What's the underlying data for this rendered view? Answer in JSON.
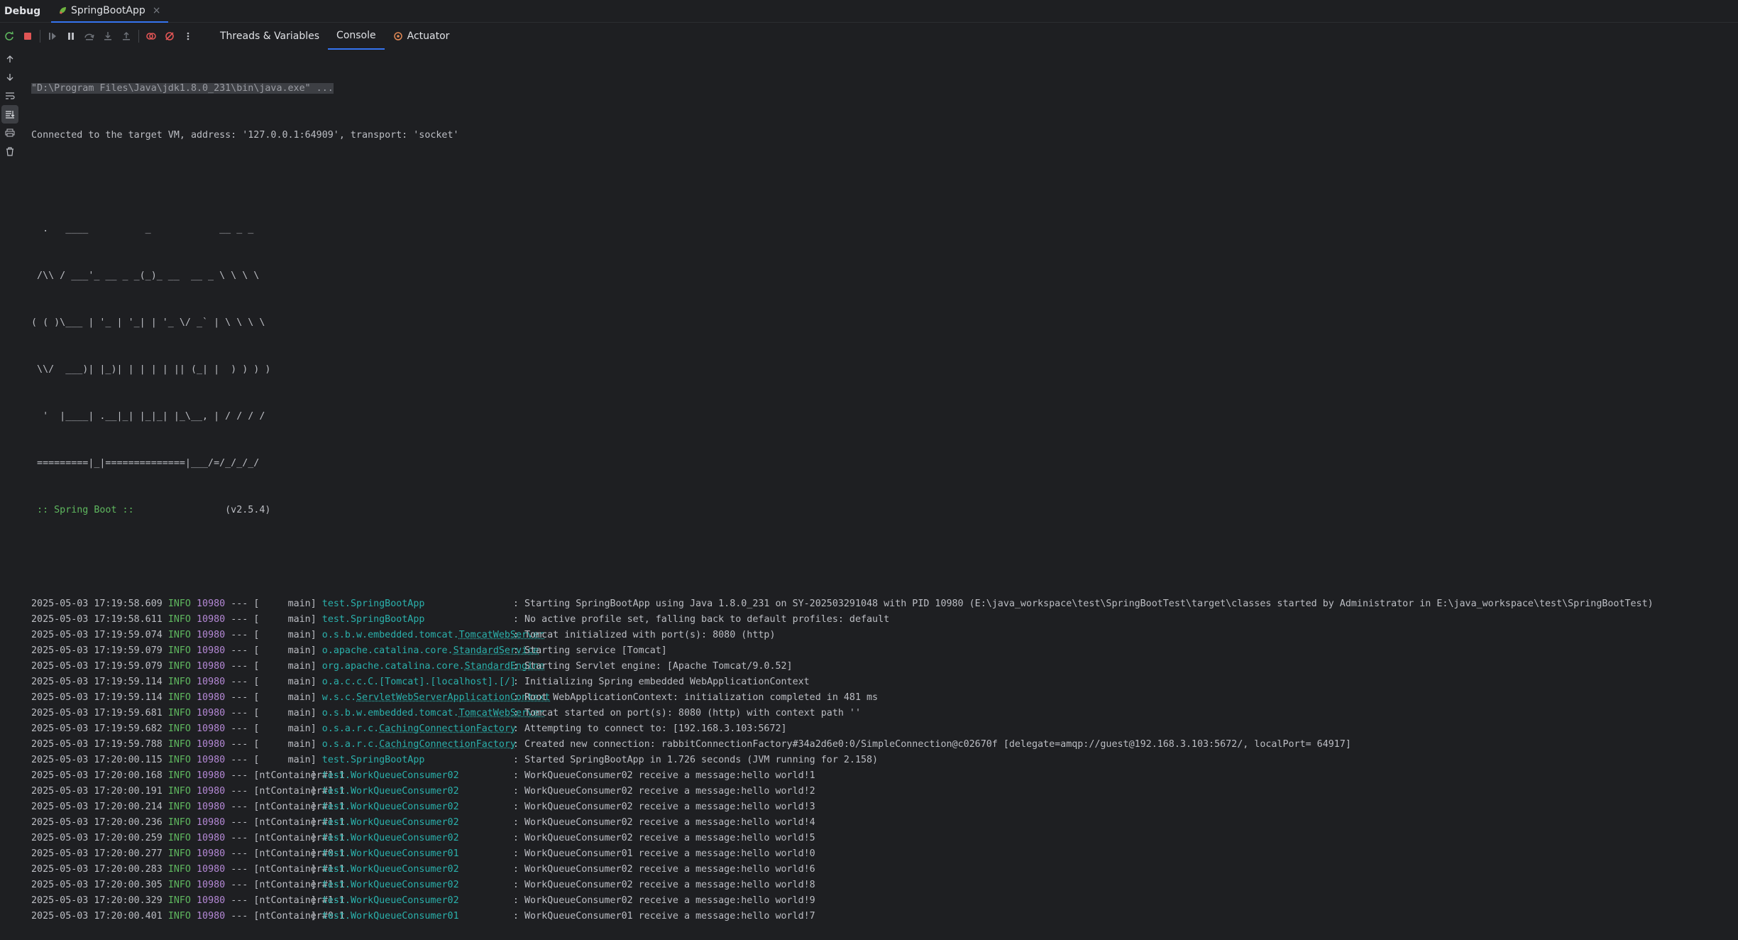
{
  "header": {
    "title": "Debug",
    "run_tab": "SpringBootApp",
    "close_glyph": "×"
  },
  "toolbar": {
    "icons": [
      "rerun-icon",
      "stop-icon",
      "resume-icon",
      "pause-icon",
      "step-over-icon",
      "step-into-icon",
      "step-out-icon",
      "view-breakpoints-icon",
      "mute-breakpoints-icon",
      "more-icon"
    ],
    "tabs": [
      {
        "label": "Threads & Variables"
      },
      {
        "label": "Console"
      },
      {
        "label": "Actuator"
      }
    ]
  },
  "sidebar": {
    "icons": [
      "scroll-up-icon",
      "scroll-down-icon",
      "soft-wrap-icon",
      "scroll-to-end-icon",
      "print-icon",
      "clear-icon"
    ]
  },
  "console": {
    "command": "\"D:\\Program Files\\Java\\jdk1.8.0_231\\bin\\java.exe\" ...",
    "connected": "Connected to the target VM, address: '127.0.0.1:64909', transport: 'socket'",
    "banner": [
      "  .   ____          _            __ _ _",
      " /\\\\ / ___'_ __ _ _(_)_ __  __ _ \\ \\ \\ \\",
      "( ( )\\___ | '_ | '_| | '_ \\/ _` | \\ \\ \\ \\",
      " \\\\/  ___)| |_)| | | | | || (_| |  ) ) ) )",
      "  '  |____| .__|_| |_|_| |_\\__, | / / / /",
      " =========|_|==============|___/=/_/_/_/"
    ],
    "spring_label": " :: Spring Boot :: ",
    "spring_version": "               (v2.5.4)",
    "logs": [
      {
        "ts": "2025-05-03 17:19:58.609",
        "level": "INFO",
        "pid": "10980",
        "sep": "---",
        "thread": "main",
        "logger": "test.SpringBootApp",
        "ul": "",
        "msg": "Starting SpringBootApp using Java 1.8.0_231 on SY-202503291048 with PID 10980 (E:\\java_workspace\\test\\SpringBootTest\\target\\classes started by Administrator in E:\\java_workspace\\test\\SpringBootTest)"
      },
      {
        "ts": "2025-05-03 17:19:58.611",
        "level": "INFO",
        "pid": "10980",
        "sep": "---",
        "thread": "main",
        "logger": "test.SpringBootApp",
        "ul": "",
        "msg": "No active profile set, falling back to default profiles: default"
      },
      {
        "ts": "2025-05-03 17:19:59.074",
        "level": "INFO",
        "pid": "10980",
        "sep": "---",
        "thread": "main",
        "logger": "o.s.b.w.embedded.tomcat.",
        "ul": "TomcatWebServer",
        "msg": "Tomcat initialized with port(s): 8080 (http)"
      },
      {
        "ts": "2025-05-03 17:19:59.079",
        "level": "INFO",
        "pid": "10980",
        "sep": "---",
        "thread": "main",
        "logger": "o.apache.catalina.core.",
        "ul": "StandardService",
        "msg": "Starting service [Tomcat]"
      },
      {
        "ts": "2025-05-03 17:19:59.079",
        "level": "INFO",
        "pid": "10980",
        "sep": "---",
        "thread": "main",
        "logger": "org.apache.catalina.core.",
        "ul": "StandardEngine",
        "msg": "Starting Servlet engine: [Apache Tomcat/9.0.52]"
      },
      {
        "ts": "2025-05-03 17:19:59.114",
        "level": "INFO",
        "pid": "10980",
        "sep": "---",
        "thread": "main",
        "logger": "o.a.c.c.C.[Tomcat].[localhost].[/]",
        "ul": "",
        "msg": "Initializing Spring embedded WebApplicationContext"
      },
      {
        "ts": "2025-05-03 17:19:59.114",
        "level": "INFO",
        "pid": "10980",
        "sep": "---",
        "thread": "main",
        "logger": "w.s.c.",
        "ul": "ServletWebServerApplicationContext",
        "msg": "Root WebApplicationContext: initialization completed in 481 ms"
      },
      {
        "ts": "2025-05-03 17:19:59.681",
        "level": "INFO",
        "pid": "10980",
        "sep": "---",
        "thread": "main",
        "logger": "o.s.b.w.embedded.tomcat.",
        "ul": "TomcatWebServer",
        "msg": "Tomcat started on port(s): 8080 (http) with context path ''"
      },
      {
        "ts": "2025-05-03 17:19:59.682",
        "level": "INFO",
        "pid": "10980",
        "sep": "---",
        "thread": "main",
        "logger": "o.s.a.r.c.",
        "ul": "CachingConnectionFactory",
        "msg": "Attempting to connect to: [192.168.3.103:5672]"
      },
      {
        "ts": "2025-05-03 17:19:59.788",
        "level": "INFO",
        "pid": "10980",
        "sep": "---",
        "thread": "main",
        "logger": "o.s.a.r.c.",
        "ul": "CachingConnectionFactory",
        "msg": "Created new connection: rabbitConnectionFactory#34a2d6e0:0/SimpleConnection@c02670f [delegate=amqp://guest@192.168.3.103:5672/, localPort= 64917]"
      },
      {
        "ts": "2025-05-03 17:20:00.115",
        "level": "INFO",
        "pid": "10980",
        "sep": "---",
        "thread": "main",
        "logger": "test.SpringBootApp",
        "ul": "",
        "msg": "Started SpringBootApp in 1.726 seconds (JVM running for 2.158)"
      },
      {
        "ts": "2025-05-03 17:20:00.168",
        "level": "INFO",
        "pid": "10980",
        "sep": "---",
        "thread": "ntContainer#1-1",
        "logger": "test.WorkQueueConsumer02",
        "ul": "",
        "msg": "WorkQueueConsumer02 receive a message:hello world!1"
      },
      {
        "ts": "2025-05-03 17:20:00.191",
        "level": "INFO",
        "pid": "10980",
        "sep": "---",
        "thread": "ntContainer#1-1",
        "logger": "test.WorkQueueConsumer02",
        "ul": "",
        "msg": "WorkQueueConsumer02 receive a message:hello world!2"
      },
      {
        "ts": "2025-05-03 17:20:00.214",
        "level": "INFO",
        "pid": "10980",
        "sep": "---",
        "thread": "ntContainer#1-1",
        "logger": "test.WorkQueueConsumer02",
        "ul": "",
        "msg": "WorkQueueConsumer02 receive a message:hello world!3"
      },
      {
        "ts": "2025-05-03 17:20:00.236",
        "level": "INFO",
        "pid": "10980",
        "sep": "---",
        "thread": "ntContainer#1-1",
        "logger": "test.WorkQueueConsumer02",
        "ul": "",
        "msg": "WorkQueueConsumer02 receive a message:hello world!4"
      },
      {
        "ts": "2025-05-03 17:20:00.259",
        "level": "INFO",
        "pid": "10980",
        "sep": "---",
        "thread": "ntContainer#1-1",
        "logger": "test.WorkQueueConsumer02",
        "ul": "",
        "msg": "WorkQueueConsumer02 receive a message:hello world!5"
      },
      {
        "ts": "2025-05-03 17:20:00.277",
        "level": "INFO",
        "pid": "10980",
        "sep": "---",
        "thread": "ntContainer#0-1",
        "logger": "test.WorkQueueConsumer01",
        "ul": "",
        "msg": "WorkQueueConsumer01 receive a message:hello world!0"
      },
      {
        "ts": "2025-05-03 17:20:00.283",
        "level": "INFO",
        "pid": "10980",
        "sep": "---",
        "thread": "ntContainer#1-1",
        "logger": "test.WorkQueueConsumer02",
        "ul": "",
        "msg": "WorkQueueConsumer02 receive a message:hello world!6"
      },
      {
        "ts": "2025-05-03 17:20:00.305",
        "level": "INFO",
        "pid": "10980",
        "sep": "---",
        "thread": "ntContainer#1-1",
        "logger": "test.WorkQueueConsumer02",
        "ul": "",
        "msg": "WorkQueueConsumer02 receive a message:hello world!8"
      },
      {
        "ts": "2025-05-03 17:20:00.329",
        "level": "INFO",
        "pid": "10980",
        "sep": "---",
        "thread": "ntContainer#1-1",
        "logger": "test.WorkQueueConsumer02",
        "ul": "",
        "msg": "WorkQueueConsumer02 receive a message:hello world!9"
      },
      {
        "ts": "2025-05-03 17:20:00.401",
        "level": "INFO",
        "pid": "10980",
        "sep": "---",
        "thread": "ntContainer#0-1",
        "logger": "test.WorkQueueConsumer01",
        "ul": "",
        "msg": "WorkQueueConsumer01 receive a message:hello world!7"
      }
    ]
  }
}
